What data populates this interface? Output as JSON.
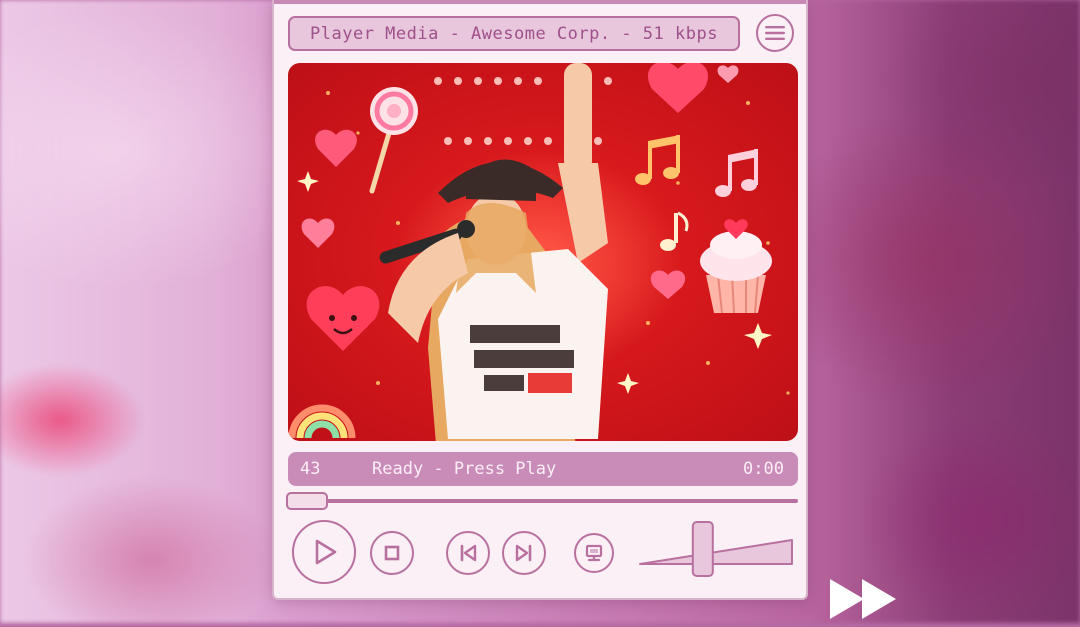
{
  "window": {
    "title": "Player Media - Awesome Corp. - 51 kbps"
  },
  "icons": {
    "menu": "hamburger-menu-icon",
    "play": "play-icon",
    "stop": "stop-icon",
    "previous": "skip-previous-icon",
    "next": "skip-next-icon",
    "screen": "monitor-icon",
    "fast_forward": "fast-forward-icon"
  },
  "status": {
    "track_number": "43",
    "message": "Ready - Press Play",
    "time": "0:00"
  },
  "seek": {
    "position_fraction": 0.0
  },
  "volume": {
    "level_fraction": 0.4
  },
  "colors": {
    "accent": "#b8709f",
    "status_bar": "#c98bb8",
    "title_bar_fill": "#e8c6dc",
    "panel": "#fbf0f6",
    "artwork_red": "#e8201f"
  }
}
